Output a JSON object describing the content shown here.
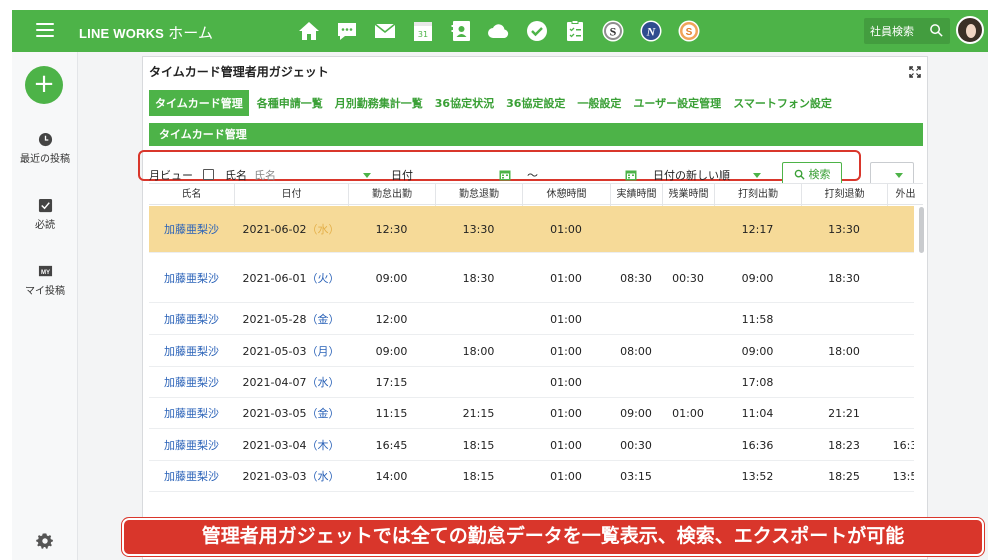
{
  "app": {
    "brand": "LINE WORKS",
    "home": "ホーム"
  },
  "top_icons": [
    "home-icon",
    "chat-icon",
    "mail-icon",
    "calendar-icon",
    "contacts-icon",
    "cloud-icon",
    "check-icon",
    "clipboard-icon",
    "s-app-icon",
    "n-app-icon",
    "coin-app-icon"
  ],
  "calendar_badge": "31",
  "header": {
    "search_placeholder": "社員検索"
  },
  "left_nav": {
    "items": [
      {
        "label": "最近の投稿",
        "icon": "clock-icon"
      },
      {
        "label": "必読",
        "icon": "checkbox-icon"
      },
      {
        "label": "マイ投稿",
        "icon": "my-icon",
        "icon_text": "MY"
      }
    ]
  },
  "gadget": {
    "title": "タイムカード管理者用ガジェット",
    "tabs": [
      "タイムカード管理",
      "各種申請一覧",
      "月別勤務集計一覧",
      "36協定状況",
      "36協定設定",
      "一般設定",
      "ユーザー設定管理",
      "スマートフォン設定"
    ],
    "section_title": "タイムカード管理",
    "filters": {
      "month_view": "月ビュー",
      "name_label": "氏名",
      "name_placeholder": "氏名",
      "date_label": "日付",
      "range_sep": "〜",
      "sort": "日付の新しい順",
      "search_button": "検索"
    },
    "columns": [
      "氏名",
      "日付",
      "勤怠出勤",
      "勤怠退勤",
      "休憩時間",
      "実績時間",
      "残業時間",
      "打刻出勤",
      "打刻退勤",
      "外出"
    ],
    "rows": [
      {
        "name": "加藤亜梨沙",
        "date": "2021-06-02",
        "weekday": "（水）",
        "att_in": "12:30",
        "att_out": "13:30",
        "break": "01:00",
        "actual": "",
        "overtime": "",
        "stamp_in": "12:17",
        "stamp_out": "13:30",
        "out": "",
        "highlight": true
      },
      {
        "name": "加藤亜梨沙",
        "date": "2021-06-01",
        "weekday": "（火）",
        "att_in": "09:00",
        "att_out": "18:30",
        "break": "01:00",
        "actual": "08:30",
        "overtime": "00:30",
        "stamp_in": "09:00",
        "stamp_out": "18:30",
        "out": ""
      },
      {
        "name": "加藤亜梨沙",
        "date": "2021-05-28",
        "weekday": "（金）",
        "att_in": "12:00",
        "att_out": "",
        "break": "01:00",
        "actual": "",
        "overtime": "",
        "stamp_in": "11:58",
        "stamp_out": "",
        "out": ""
      },
      {
        "name": "加藤亜梨沙",
        "date": "2021-05-03",
        "weekday": "（月）",
        "att_in": "09:00",
        "att_out": "18:00",
        "break": "01:00",
        "actual": "08:00",
        "overtime": "",
        "stamp_in": "09:00",
        "stamp_out": "18:00",
        "out": ""
      },
      {
        "name": "加藤亜梨沙",
        "date": "2021-04-07",
        "weekday": "（水）",
        "att_in": "17:15",
        "att_out": "",
        "break": "01:00",
        "actual": "",
        "overtime": "",
        "stamp_in": "17:08",
        "stamp_out": "",
        "out": ""
      },
      {
        "name": "加藤亜梨沙",
        "date": "2021-03-05",
        "weekday": "（金）",
        "att_in": "11:15",
        "att_out": "21:15",
        "break": "01:00",
        "actual": "09:00",
        "overtime": "01:00",
        "stamp_in": "11:04",
        "stamp_out": "21:21",
        "out": ""
      },
      {
        "name": "加藤亜梨沙",
        "date": "2021-03-04",
        "weekday": "（木）",
        "att_in": "16:45",
        "att_out": "18:15",
        "break": "01:00",
        "actual": "00:30",
        "overtime": "",
        "stamp_in": "16:36",
        "stamp_out": "18:23",
        "out": "16:3"
      },
      {
        "name": "加藤亜梨沙",
        "date": "2021-03-03",
        "weekday": "（水）",
        "att_in": "14:00",
        "att_out": "18:15",
        "break": "01:00",
        "actual": "03:15",
        "overtime": "",
        "stamp_in": "13:52",
        "stamp_out": "18:25",
        "out": "13:5"
      }
    ]
  },
  "banner": "管理者用ガジェットでは全ての勤怠データを一覧表示、検索、エクスポートが可能",
  "colors": {
    "brand_green": "#4db348",
    "highlight_row": "#f6da98",
    "banner_red": "#d9362b",
    "link_blue": "#2a62b8"
  }
}
